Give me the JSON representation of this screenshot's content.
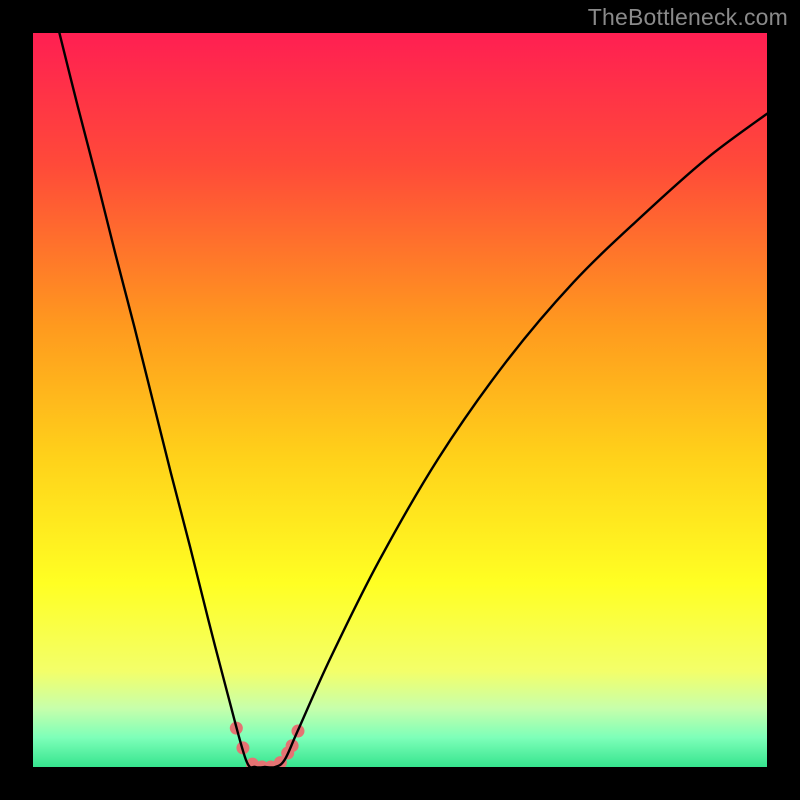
{
  "watermark": "TheBottleneck.com",
  "chart_data": {
    "type": "line",
    "title": "",
    "xlabel": "",
    "ylabel": "",
    "xlim": [
      0,
      100
    ],
    "ylim": [
      0,
      100
    ],
    "gradient_stops": [
      {
        "offset": 0,
        "color": "#ff1f52"
      },
      {
        "offset": 0.18,
        "color": "#ff4a39"
      },
      {
        "offset": 0.4,
        "color": "#ff9a1e"
      },
      {
        "offset": 0.58,
        "color": "#ffd21a"
      },
      {
        "offset": 0.75,
        "color": "#ffff23"
      },
      {
        "offset": 0.87,
        "color": "#f3ff6a"
      },
      {
        "offset": 0.92,
        "color": "#c7ffab"
      },
      {
        "offset": 0.96,
        "color": "#7dffb9"
      },
      {
        "offset": 1.0,
        "color": "#36e48e"
      }
    ],
    "series": [
      {
        "name": "left-branch",
        "x": [
          3.6,
          6.1,
          8.7,
          11.2,
          13.8,
          16.3,
          18.8,
          21.4,
          23.9,
          26.5,
          29.0,
          30.3,
          31.6
        ],
        "y": [
          100.0,
          90.0,
          80.0,
          70.0,
          60.0,
          50.0,
          40.0,
          30.0,
          20.0,
          10.0,
          1.0,
          0.0,
          0.0
        ]
      },
      {
        "name": "right-branch",
        "x": [
          31.6,
          33.0,
          34.3,
          36.1,
          40.6,
          47.1,
          55.2,
          64.3,
          73.6,
          82.9,
          91.9,
          100.0
        ],
        "y": [
          0.0,
          0.0,
          1.0,
          5.0,
          15.0,
          28.0,
          42.0,
          55.0,
          66.0,
          75.0,
          83.0,
          89.0
        ]
      }
    ],
    "markers": [
      {
        "x": 27.7,
        "y": 5.3
      },
      {
        "x": 28.6,
        "y": 2.6
      },
      {
        "x": 29.9,
        "y": 0.4
      },
      {
        "x": 31.2,
        "y": 0.0
      },
      {
        "x": 32.4,
        "y": 0.0
      },
      {
        "x": 33.7,
        "y": 0.6
      },
      {
        "x": 34.7,
        "y": 1.9
      },
      {
        "x": 35.3,
        "y": 2.9
      },
      {
        "x": 36.1,
        "y": 4.9
      }
    ],
    "marker_color": "#e57373",
    "curve_color": "#000000"
  }
}
